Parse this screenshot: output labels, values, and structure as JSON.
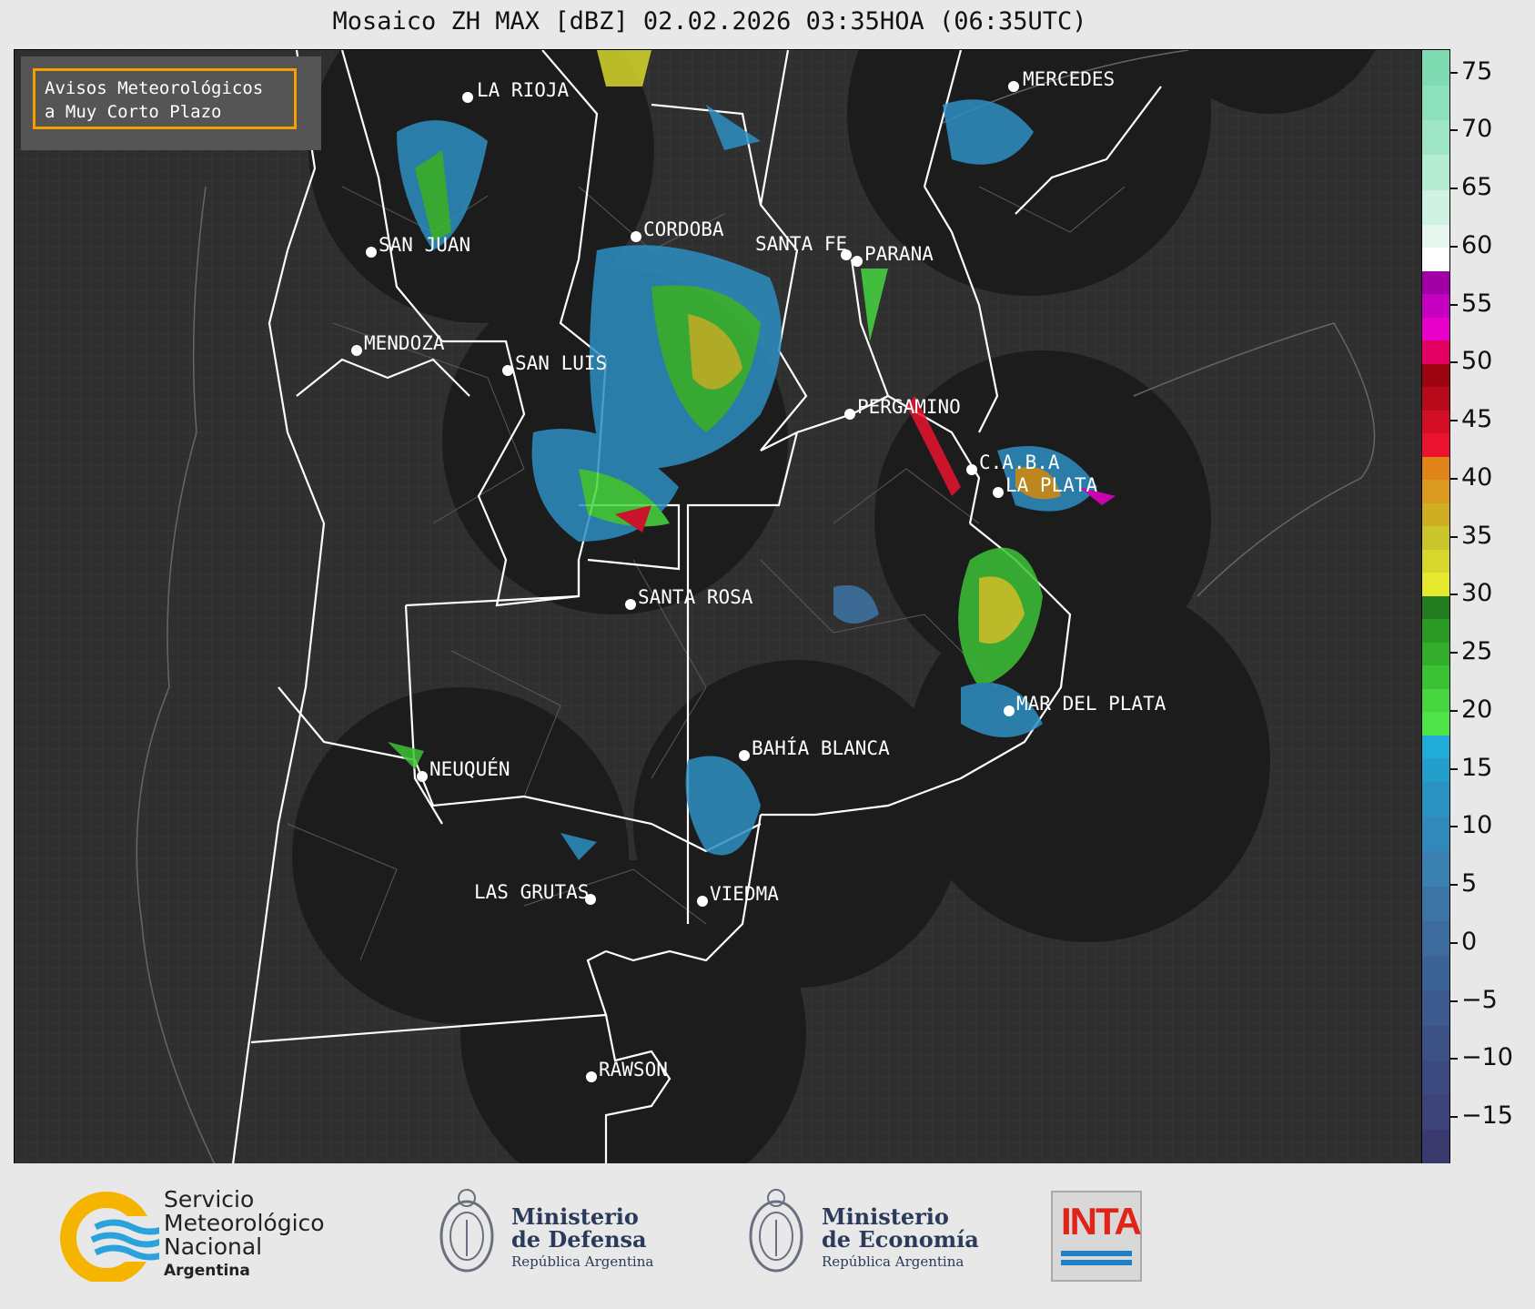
{
  "title": "Mosaico ZH MAX [dBZ] 02.02.2026 03:35HOA (06:35UTC)",
  "notice": {
    "text": "Avisos Meteorológicos\na Muy Corto Plazo",
    "border_color": "#f5a000"
  },
  "cities": [
    {
      "name": "LA RIOJA"
    },
    {
      "name": "MERCEDES"
    },
    {
      "name": "SAN JUAN"
    },
    {
      "name": "CORDOBA"
    },
    {
      "name": "SANTA FE"
    },
    {
      "name": "PARANA"
    },
    {
      "name": "MENDOZA"
    },
    {
      "name": "SAN LUIS"
    },
    {
      "name": "PERGAMINO"
    },
    {
      "name": "C.A.B.A"
    },
    {
      "name": "LA PLATA"
    },
    {
      "name": "SANTA ROSA"
    },
    {
      "name": "MAR DEL PLATA"
    },
    {
      "name": "BAHÍA BLANCA"
    },
    {
      "name": "NEUQUÉN"
    },
    {
      "name": "LAS GRUTAS"
    },
    {
      "name": "VIEDMA"
    },
    {
      "name": "RAWSON"
    }
  ],
  "colorbar": {
    "unit": "dBZ",
    "min": -19,
    "max": 77,
    "ticks": [
      "75",
      "70",
      "65",
      "60",
      "55",
      "50",
      "45",
      "40",
      "35",
      "30",
      "25",
      "20",
      "15",
      "10",
      "5",
      "0",
      "−5",
      "−10",
      "−15"
    ],
    "bands": [
      {
        "from": -19,
        "to": -16,
        "color": "#3a3a6e"
      },
      {
        "from": -16,
        "to": -13,
        "color": "#3b4378"
      },
      {
        "from": -13,
        "to": -10,
        "color": "#3c4a80"
      },
      {
        "from": -10,
        "to": -7,
        "color": "#3c5287"
      },
      {
        "from": -7,
        "to": -4,
        "color": "#3d5a8e"
      },
      {
        "from": -4,
        "to": -1,
        "color": "#3d6296"
      },
      {
        "from": -1,
        "to": 2,
        "color": "#3d6b9e"
      },
      {
        "from": 2,
        "to": 5,
        "color": "#3d74a6"
      },
      {
        "from": 5,
        "to": 8,
        "color": "#3a80b0"
      },
      {
        "from": 8,
        "to": 11,
        "color": "#3189ba"
      },
      {
        "from": 11,
        "to": 14,
        "color": "#2a93c2"
      },
      {
        "from": 14,
        "to": 16,
        "color": "#249ecb"
      },
      {
        "from": 16,
        "to": 18,
        "color": "#21acd7"
      },
      {
        "from": 18,
        "to": 20,
        "color": "#4fe34a"
      },
      {
        "from": 20,
        "to": 22,
        "color": "#47d63f"
      },
      {
        "from": 22,
        "to": 24,
        "color": "#3cc135"
      },
      {
        "from": 24,
        "to": 26,
        "color": "#34ad2c"
      },
      {
        "from": 26,
        "to": 28,
        "color": "#2b9a24"
      },
      {
        "from": 28,
        "to": 30,
        "color": "#237c1f"
      },
      {
        "from": 30,
        "to": 32,
        "color": "#e6e82e"
      },
      {
        "from": 32,
        "to": 34,
        "color": "#d7d62c"
      },
      {
        "from": 34,
        "to": 36,
        "color": "#c9c52a"
      },
      {
        "from": 36,
        "to": 38,
        "color": "#cfae24"
      },
      {
        "from": 38,
        "to": 40,
        "color": "#d99a1f"
      },
      {
        "from": 40,
        "to": 42,
        "color": "#e08319"
      },
      {
        "from": 42,
        "to": 44,
        "color": "#e9132f"
      },
      {
        "from": 44,
        "to": 46,
        "color": "#d30e25"
      },
      {
        "from": 46,
        "to": 48,
        "color": "#b70a1a"
      },
      {
        "from": 48,
        "to": 50,
        "color": "#9d0611"
      },
      {
        "from": 50,
        "to": 52,
        "color": "#e50064"
      },
      {
        "from": 52,
        "to": 54,
        "color": "#e800c8"
      },
      {
        "from": 54,
        "to": 56,
        "color": "#c600c0"
      },
      {
        "from": 56,
        "to": 58,
        "color": "#a000a6"
      },
      {
        "from": 58,
        "to": 60,
        "color": "#ffffff"
      },
      {
        "from": 60,
        "to": 62,
        "color": "#e6f7ef"
      },
      {
        "from": 62,
        "to": 65,
        "color": "#cff2e2"
      },
      {
        "from": 65,
        "to": 68,
        "color": "#b5ecd4"
      },
      {
        "from": 68,
        "to": 71,
        "color": "#9ee6c6"
      },
      {
        "from": 71,
        "to": 74,
        "color": "#8ce0bb"
      },
      {
        "from": 74,
        "to": 77,
        "color": "#7fdbb2"
      }
    ]
  },
  "footer": {
    "smn": {
      "line1": "Servicio",
      "line2": "Meteorológico",
      "line3": "Nacional",
      "country": "Argentina"
    },
    "defensa": {
      "line1": "Ministerio",
      "line2": "de Defensa",
      "sub": "República Argentina"
    },
    "economia": {
      "line1": "Ministerio",
      "line2": "de Economía",
      "sub": "República Argentina"
    },
    "inta": {
      "label": "INTA"
    }
  }
}
